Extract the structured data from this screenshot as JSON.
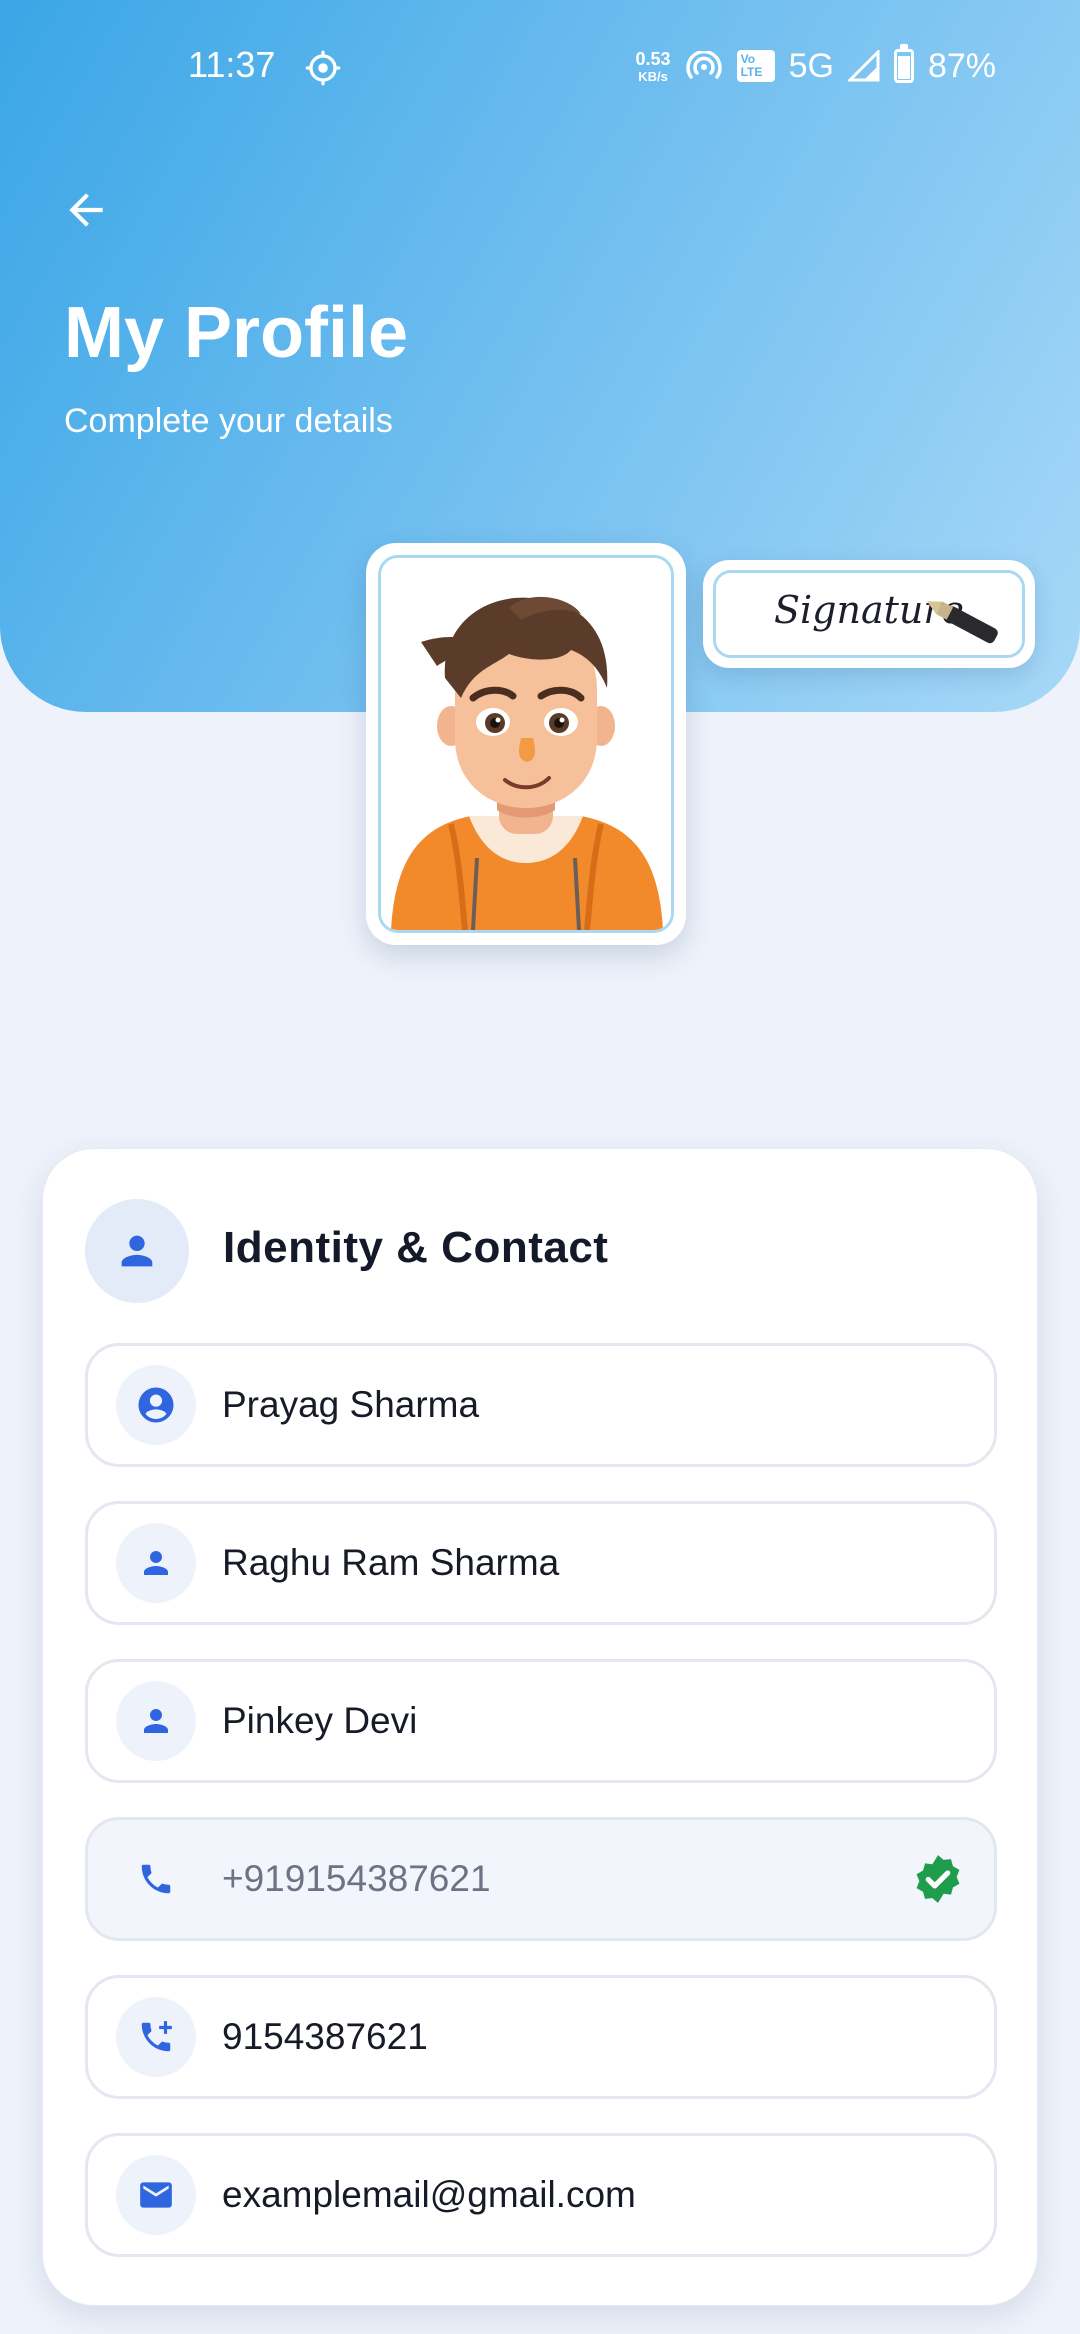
{
  "status_bar": {
    "time": "11:37",
    "net_speed_value": "0.53",
    "net_speed_unit": "KB/s",
    "volte_top": "Vo",
    "volte_bottom": "LTE",
    "network": "5G",
    "battery": "87%"
  },
  "header": {
    "title": "My Profile",
    "subtitle": "Complete your details"
  },
  "signature": {
    "text": "Signature"
  },
  "section": {
    "title": "Identity & Contact"
  },
  "fields": [
    {
      "icon": "account-circle-icon",
      "value": "Prayag Sharma"
    },
    {
      "icon": "person-icon",
      "value": "Raghu Ram Sharma"
    },
    {
      "icon": "person-icon",
      "value": "Pinkey Devi"
    },
    {
      "icon": "phone-icon",
      "value": "+919154387621",
      "verified": true
    },
    {
      "icon": "phone-add-icon",
      "value": "9154387621"
    },
    {
      "icon": "mail-icon",
      "value": "examplemail@gmail.com"
    }
  ],
  "colors": {
    "accent": "#2f66e0",
    "header_start": "#3aa6e6",
    "header_end": "#a7d8f7",
    "verified": "#1f9d4c"
  }
}
